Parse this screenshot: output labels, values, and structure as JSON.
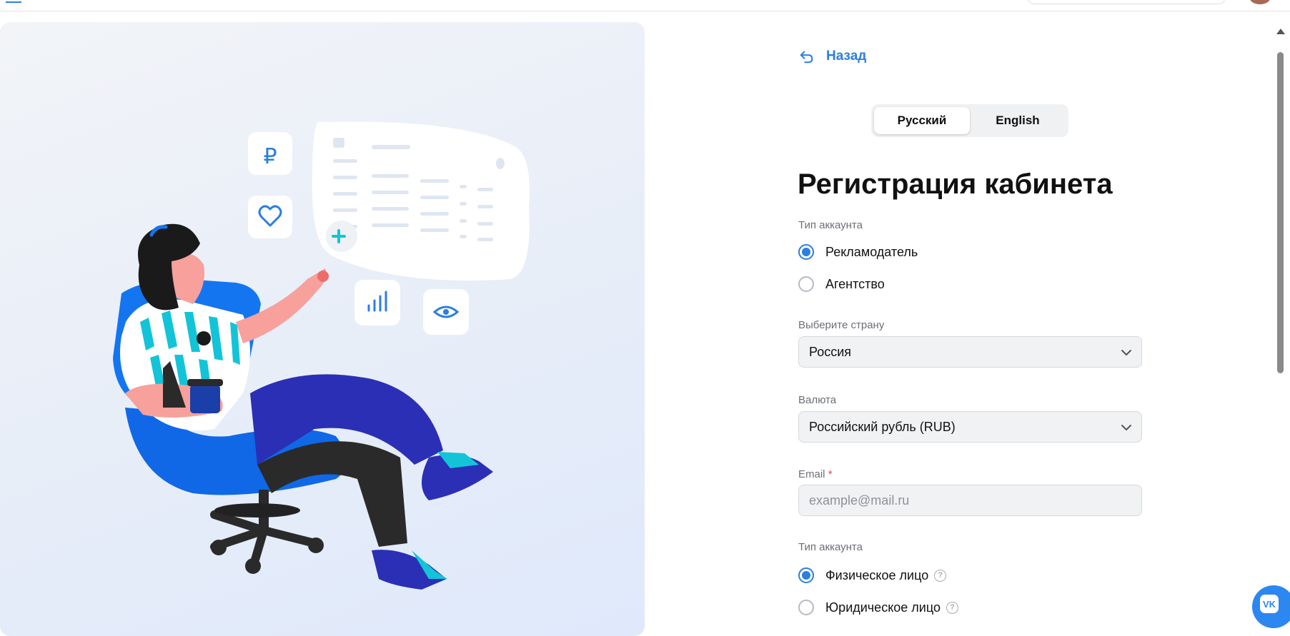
{
  "nav": {
    "back_label": "Назад"
  },
  "language_switch": {
    "options": [
      "Русский",
      "English"
    ],
    "selected": "Русский"
  },
  "page_title": "Регистрация кабинета",
  "account_type": {
    "label": "Тип аккаунта",
    "options": [
      "Рекламодатель",
      "Агентство"
    ],
    "selected": "Рекламодатель"
  },
  "country": {
    "label": "Выберите страну",
    "value": "Россия"
  },
  "currency": {
    "label": "Валюта",
    "value": "Российский рубль (RUB)"
  },
  "email": {
    "label": "Email",
    "required_mark": "*",
    "placeholder": "example@mail.ru",
    "value": ""
  },
  "legal_type": {
    "label": "Тип аккаунта",
    "options": [
      "Физическое лицо",
      "Юридическое лицо"
    ],
    "selected": "Физическое лицо",
    "help_glyph": "?"
  },
  "hero": {
    "currency_symbol": "₽"
  },
  "chat_button": {
    "logo_text": "VK"
  },
  "colors": {
    "accent": "#2c7ee0",
    "required": "#e64646",
    "field_bg": "#f1f2f4"
  }
}
